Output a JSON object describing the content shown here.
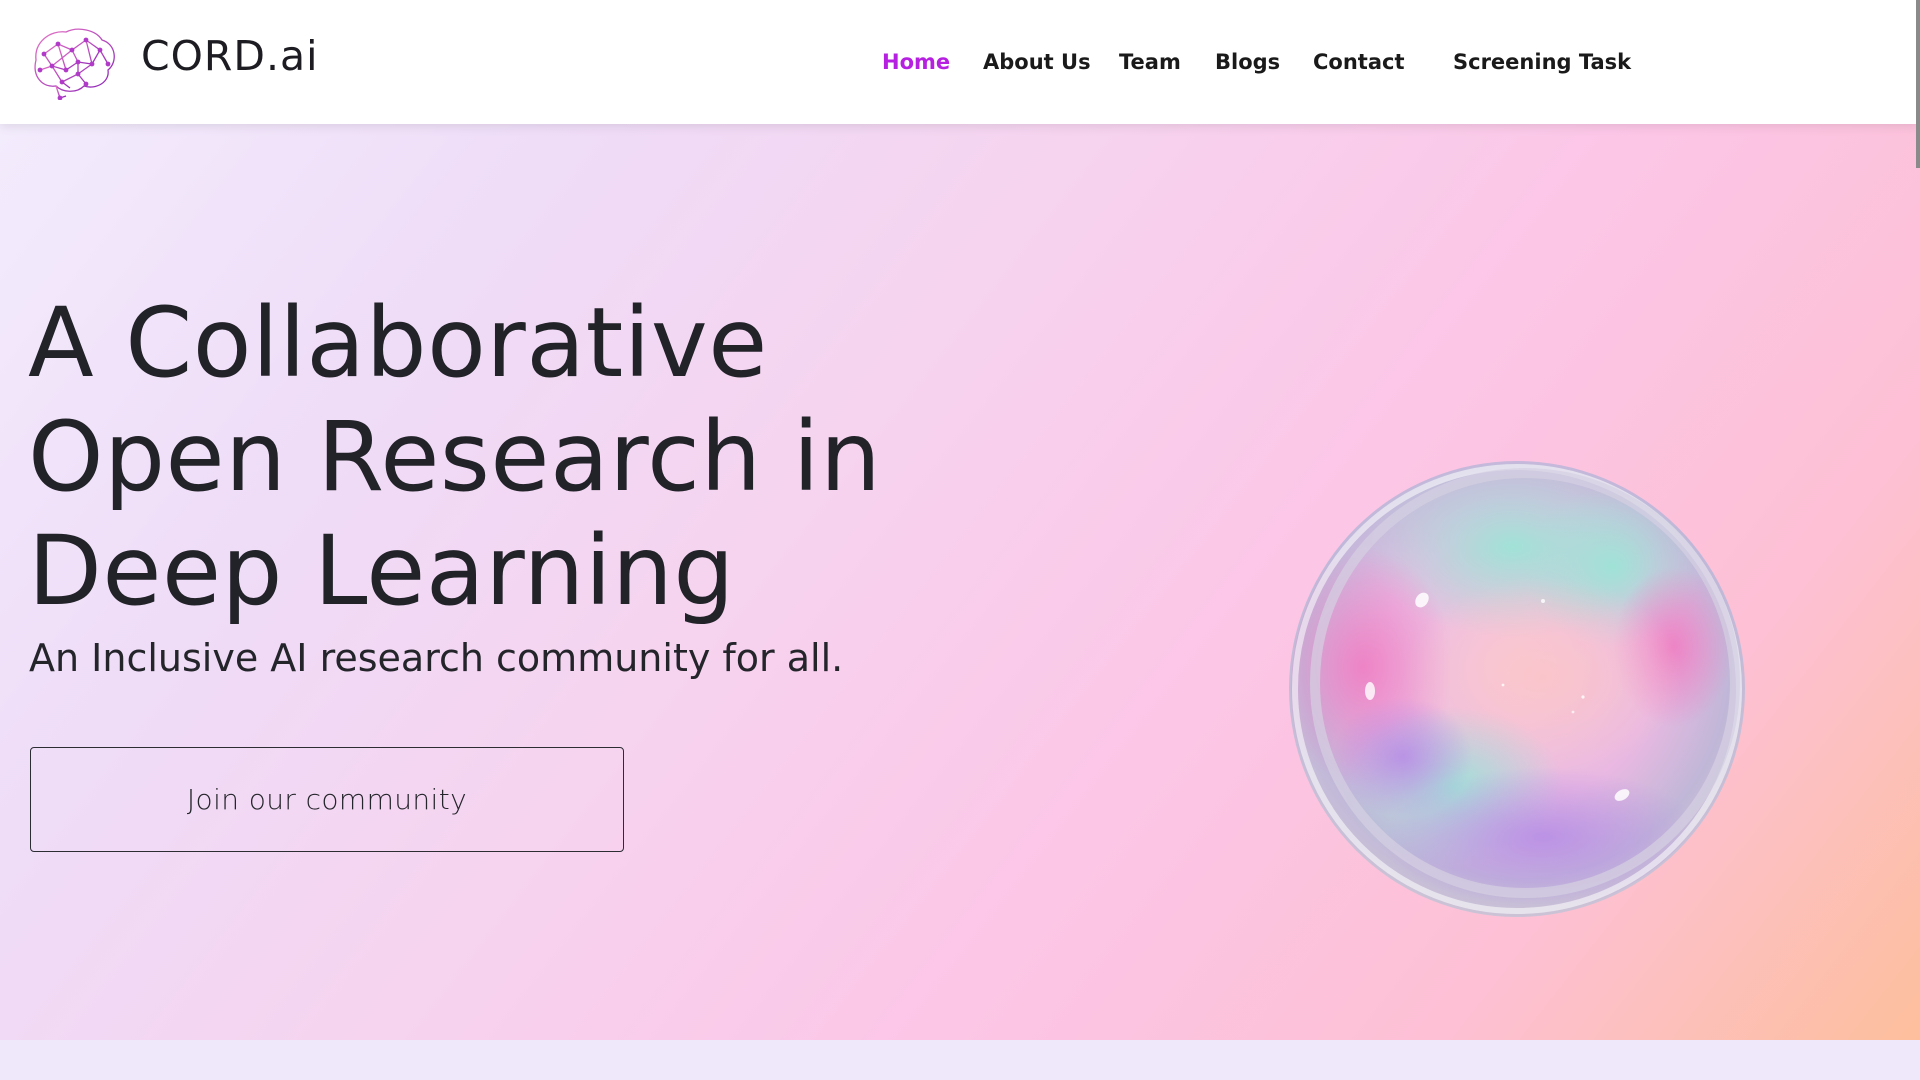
{
  "brand": {
    "name": "CORD.ai",
    "logo_icon": "brain-network-icon"
  },
  "nav": {
    "items": [
      {
        "label": "Home",
        "active": true
      },
      {
        "label": "About Us",
        "active": false
      },
      {
        "label": "Team",
        "active": false
      },
      {
        "label": "Blogs",
        "active": false
      },
      {
        "label": "Contact",
        "active": false
      },
      {
        "label": "Screening Task",
        "active": false
      }
    ]
  },
  "hero": {
    "headline_lines": [
      "A Collaborative",
      "Open Research in",
      "Deep Learning"
    ],
    "subtitle": "An Inclusive AI research community for all.",
    "cta_label": "Join our community",
    "illustration": "iridescent-bubble-illustration"
  },
  "colors": {
    "accent": "#b620e0",
    "text": "#222229",
    "hero_gradient": [
      "#f3ecfd",
      "#efdcf7",
      "#f6d3ef",
      "#fcc6e7",
      "#fdc0d4",
      "#fdbf9c"
    ],
    "bottom_band": "#efe8fb"
  }
}
